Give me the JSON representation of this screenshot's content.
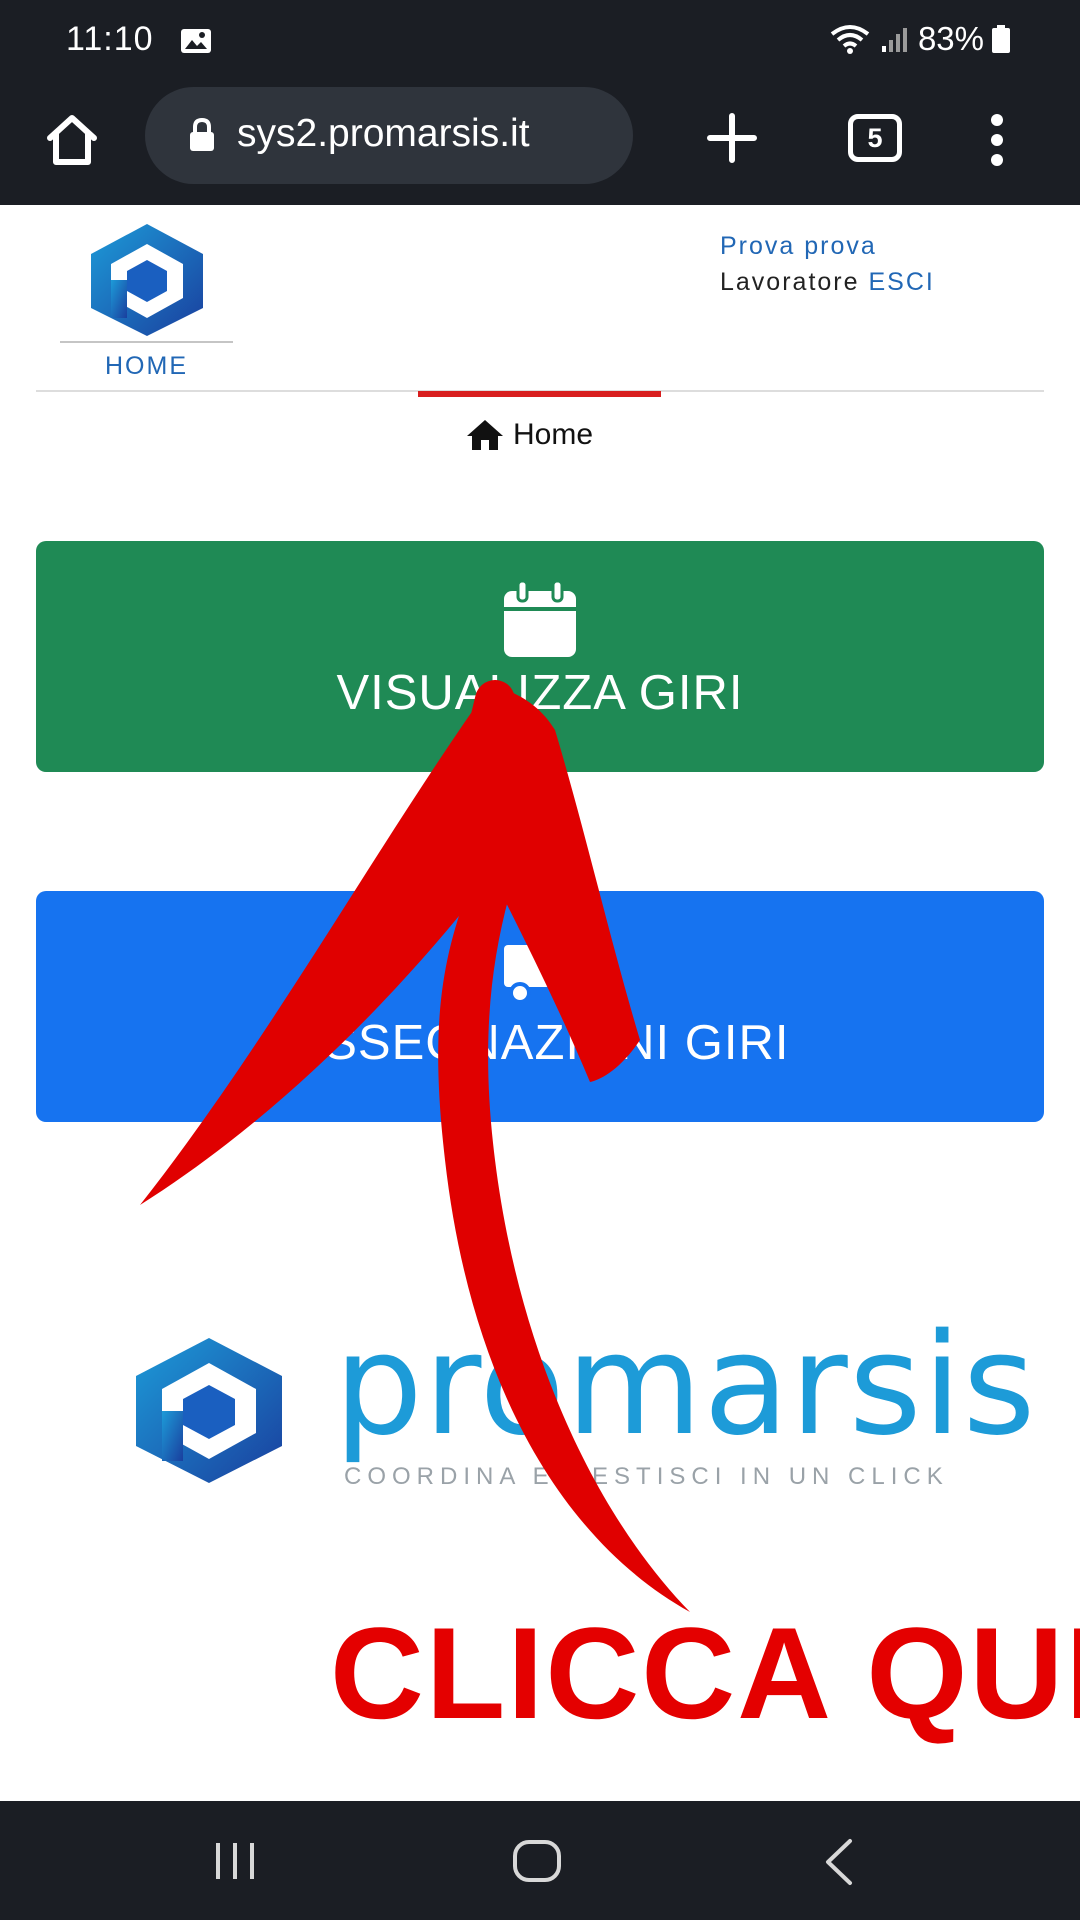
{
  "status_bar": {
    "time": "11:10",
    "battery": "83%",
    "icons": [
      "gallery-icon",
      "wifi-icon",
      "signal-icon",
      "battery-icon"
    ]
  },
  "browser": {
    "url": "sys2.promarsis.it",
    "tab_count": "5",
    "icons": [
      "home-icon",
      "lock-icon",
      "plus-icon",
      "tab-switcher-icon",
      "more-vert-icon"
    ]
  },
  "header": {
    "home_label": "HOME",
    "user_name": "Prova prova",
    "user_role": "Lavoratore",
    "logout_label": "ESCI"
  },
  "breadcrumb": {
    "label": "Home"
  },
  "actions": {
    "view_label": "VISUALIZZA GIRI",
    "assign_label": "ASSEGNAZIONI GIRI"
  },
  "brand": {
    "name": "promarsis",
    "tagline": "COORDINA E GESTISCI IN UN CLICK"
  },
  "annotation": {
    "text": "CLICCA QUI",
    "color": "#e40000"
  },
  "colors": {
    "view_button": "#1f8a55",
    "assign_button": "#1673f0",
    "link_blue": "#2167b5",
    "active_tab": "#d81e1e"
  }
}
